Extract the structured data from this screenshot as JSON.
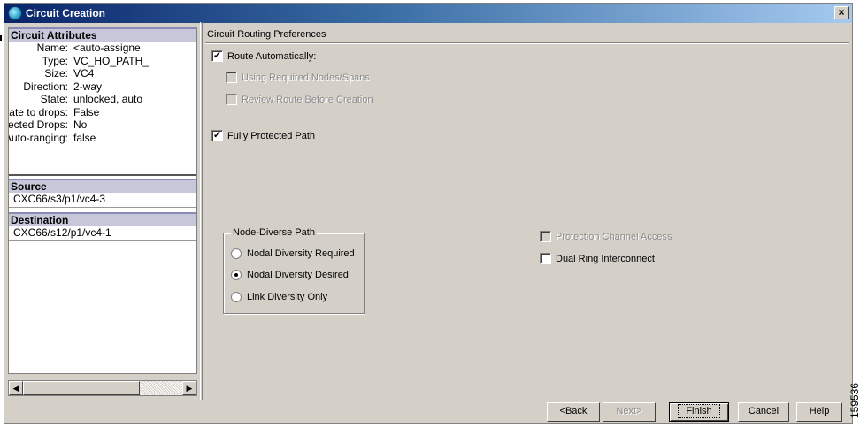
{
  "window": {
    "title": "Circuit Creation",
    "close_label": "×"
  },
  "left": {
    "attributes_header": "Circuit Attributes",
    "attributes": [
      {
        "label": "Name:",
        "value": "<auto-assigne"
      },
      {
        "label": "Type:",
        "value": "VC_HO_PATH_"
      },
      {
        "label": "Size:",
        "value": "VC4"
      },
      {
        "label": "Direction:",
        "value": "2-way"
      },
      {
        "label": "State:",
        "value": "unlocked, auto"
      },
      {
        "label": "Ckt state to drops:",
        "value": "False"
      },
      {
        "label": "Protected Drops:",
        "value": "No"
      },
      {
        "label": "Auto-ranging:",
        "value": "false"
      }
    ],
    "source_header": "Source",
    "source_value": "CXC66/s3/p1/vc4-3",
    "destination_header": "Destination",
    "destination_value": "CXC66/s12/p1/vc4-1"
  },
  "prefs": {
    "title": "Circuit Routing Preferences",
    "route_automatically": {
      "label": "Route Automatically:",
      "checked": true,
      "mark": "✓"
    },
    "using_required": {
      "label": "Using Required Nodes/Spans",
      "checked": false
    },
    "review_route": {
      "label": "Review Route Before Creation",
      "checked": false
    },
    "fully_protected": {
      "label": "Fully Protected Path",
      "checked": true,
      "mark": "✓"
    },
    "node_diverse_legend": "Node-Diverse Path",
    "diversity_options": [
      {
        "label": "Nodal Diversity Required",
        "selected": false
      },
      {
        "label": "Nodal Diversity Desired",
        "selected": true
      },
      {
        "label": "Link Diversity Only",
        "selected": false
      }
    ],
    "protection_channel": {
      "label": "Protection Channel Access",
      "checked": false
    },
    "dual_ring": {
      "label": "Dual Ring Interconnect",
      "checked": false
    }
  },
  "buttons": {
    "back": "<Back",
    "next": "Next>",
    "finish": "Finish",
    "cancel": "Cancel",
    "help": "Help"
  },
  "watermark": "159536"
}
